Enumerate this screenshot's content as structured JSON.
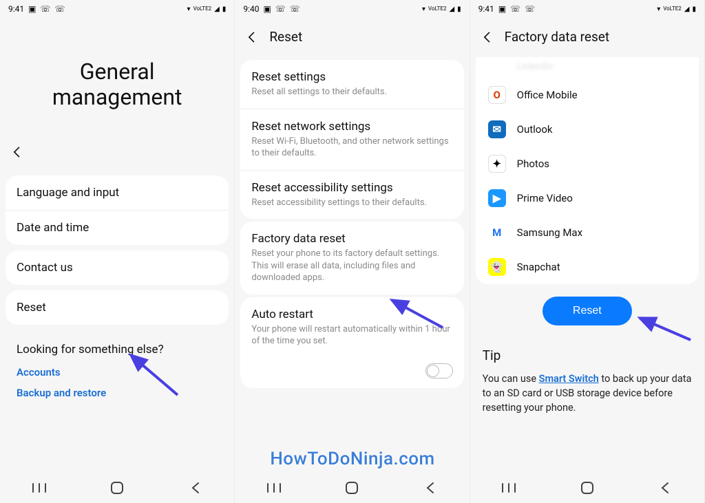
{
  "status": {
    "time1": "9:41",
    "time2": "9:40",
    "time3": "9:41",
    "lte_label": "VoLTE2",
    "signal_label": "signal",
    "wifi_label": "wifi",
    "battery_label": "battery"
  },
  "screen1": {
    "title": "General\nmanagement",
    "items": [
      "Language and input",
      "Date and time",
      "Contact us",
      "Reset"
    ],
    "else_title": "Looking for something else?",
    "else_links": [
      "Accounts",
      "Backup and restore"
    ]
  },
  "screen2": {
    "header": "Reset",
    "groups": [
      [
        {
          "title": "Reset settings",
          "sub": "Reset all settings to their defaults."
        },
        {
          "title": "Reset network settings",
          "sub": "Reset Wi-Fi, Bluetooth, and other network settings to their defaults."
        },
        {
          "title": "Reset accessibility settings",
          "sub": "Reset accessibility settings to their defaults."
        }
      ],
      [
        {
          "title": "Factory data reset",
          "sub": "Reset your phone to its factory default settings. This will erase all data, including files and downloaded apps."
        }
      ],
      [
        {
          "title": "Auto restart",
          "sub": "Your phone will restart automatically within 1 hour of the time you set."
        }
      ]
    ]
  },
  "screen3": {
    "header": "Factory data reset",
    "cut_item": "LinkedIn",
    "apps": [
      {
        "name": "Office Mobile",
        "bg": "#fff",
        "fg": "#d83b01",
        "glyph": "O",
        "border": "1px solid #ddd"
      },
      {
        "name": "Outlook",
        "bg": "#0f6cbd",
        "fg": "#fff",
        "glyph": "✉"
      },
      {
        "name": "Photos",
        "bg": "#fff",
        "fg": "#000",
        "glyph": "✦",
        "border": "1px solid #ddd"
      },
      {
        "name": "Prime Video",
        "bg": "#1a98ff",
        "fg": "#fff",
        "glyph": "▶"
      },
      {
        "name": "Samsung Max",
        "bg": "#fff",
        "fg": "#1a73e8",
        "glyph": "M",
        "border": "none"
      },
      {
        "name": "Snapchat",
        "bg": "#fffc00",
        "fg": "#000",
        "glyph": "👻"
      }
    ],
    "reset_btn": "Reset",
    "tip_title": "Tip",
    "tip_before": "You can use ",
    "tip_link": "Smart Switch",
    "tip_after": " to back up your data to an SD card or USB storage device before resetting your phone."
  },
  "watermark": "HowToDoNinja.com"
}
